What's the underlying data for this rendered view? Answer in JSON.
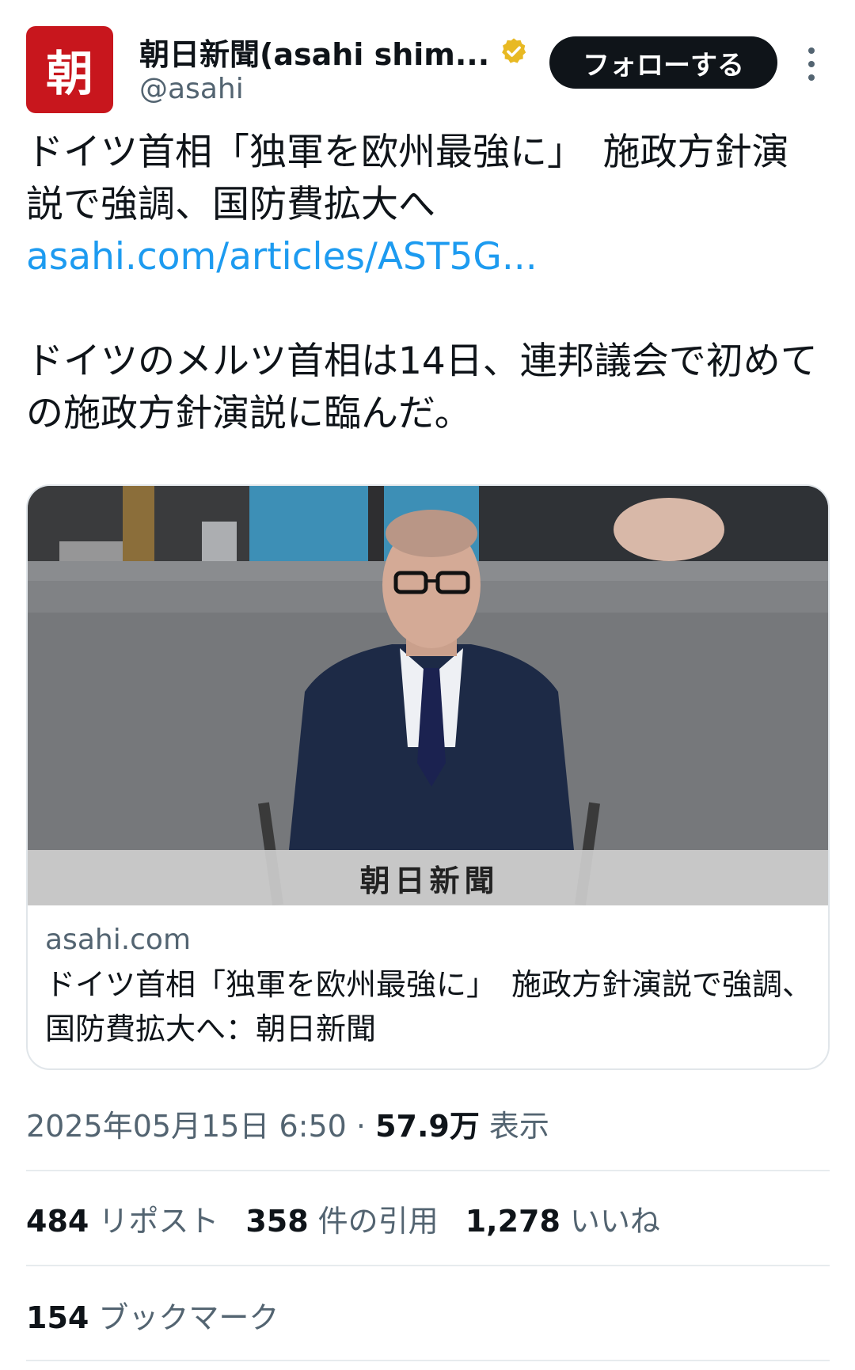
{
  "account": {
    "avatar_text": "朝",
    "display_name": "朝日新聞(asahi shim...",
    "handle": "@asahi",
    "follow_label": "フォローする",
    "verified_color": "#e8b923",
    "avatar_color": "#c8161d"
  },
  "tweet": {
    "line1_text": "ドイツ首相「独軍を欧州最強に」　施政方針演説で強調、国防費拡大へ ",
    "link_text": "asahi.com/articles/AST5G...",
    "paragraph2": "ドイツのメルツ首相は14日、連邦議会で初めての施政方針演説に臨んだ。"
  },
  "card": {
    "image_caption": "朝日新聞",
    "image_description_icon": "speaker-at-podium-photo",
    "domain": "asahi.com",
    "title": "ドイツ首相「独軍を欧州最強に」　施政方針演説で強調、国防費拡大へ：朝日新聞"
  },
  "meta": {
    "timestamp": "2025年05月15日 6:50",
    "separator": " · ",
    "views_count": "57.9万",
    "views_label": " 表示"
  },
  "stats": {
    "reposts_count": "484",
    "reposts_label": "リポスト",
    "quotes_count": "358",
    "quotes_label": "件の引用",
    "likes_count": "1,278",
    "likes_label": "いいね",
    "bookmarks_count": "154",
    "bookmarks_label": "ブックマーク"
  }
}
